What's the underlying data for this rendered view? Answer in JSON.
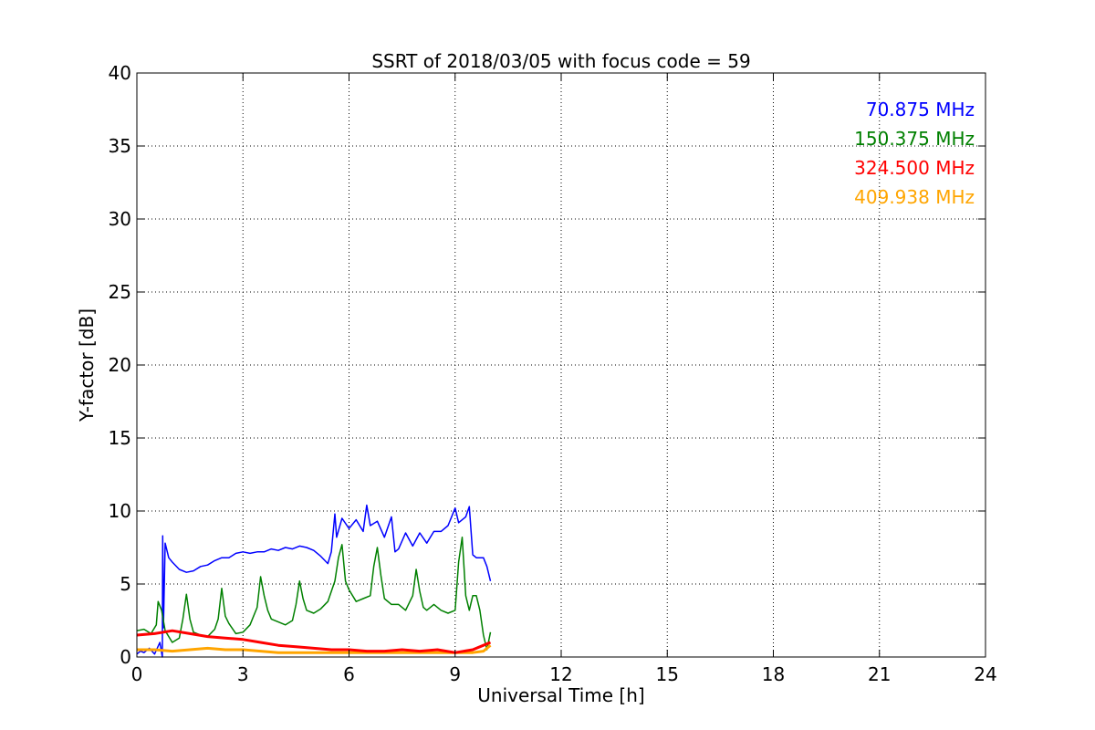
{
  "chart_data": {
    "type": "line",
    "title": "SSRT of 2018/03/05 with focus code = 59",
    "xlabel": "Universal Time [h]",
    "ylabel": "Y-factor [dB]",
    "xlim": [
      0,
      24
    ],
    "ylim": [
      0,
      40
    ],
    "xticks": [
      0,
      3,
      6,
      9,
      12,
      15,
      18,
      21,
      24
    ],
    "yticks": [
      0,
      5,
      10,
      15,
      20,
      25,
      30,
      35,
      40
    ],
    "grid": true,
    "legend_position": "top-right",
    "series": [
      {
        "name": "70.875 MHz",
        "color": "#0000ff",
        "x": [
          0.0,
          0.1,
          0.2,
          0.35,
          0.5,
          0.65,
          0.72,
          0.73,
          0.75,
          0.8,
          0.9,
          1.0,
          1.2,
          1.4,
          1.6,
          1.8,
          2.0,
          2.2,
          2.4,
          2.6,
          2.8,
          3.0,
          3.2,
          3.4,
          3.6,
          3.8,
          4.0,
          4.2,
          4.4,
          4.6,
          4.8,
          5.0,
          5.2,
          5.4,
          5.5,
          5.6,
          5.65,
          5.8,
          6.0,
          6.2,
          6.4,
          6.5,
          6.6,
          6.8,
          7.0,
          7.2,
          7.3,
          7.4,
          7.6,
          7.8,
          8.0,
          8.2,
          8.4,
          8.6,
          8.8,
          9.0,
          9.1,
          9.3,
          9.4,
          9.5,
          9.6,
          9.8,
          9.9,
          10.0
        ],
        "y": [
          0.2,
          0.4,
          0.3,
          0.6,
          0.2,
          1.0,
          0.0,
          8.3,
          2.0,
          7.8,
          6.8,
          6.5,
          6.0,
          5.8,
          5.9,
          6.2,
          6.3,
          6.6,
          6.8,
          6.8,
          7.1,
          7.2,
          7.1,
          7.2,
          7.2,
          7.4,
          7.3,
          7.5,
          7.4,
          7.6,
          7.5,
          7.3,
          6.9,
          6.4,
          7.2,
          9.8,
          8.2,
          9.5,
          8.8,
          9.4,
          8.6,
          10.4,
          9.0,
          9.3,
          8.2,
          9.6,
          7.2,
          7.4,
          8.5,
          7.6,
          8.5,
          7.8,
          8.6,
          8.6,
          9.0,
          10.2,
          9.2,
          9.6,
          10.3,
          7.0,
          6.8,
          6.8,
          6.2,
          5.2
        ]
      },
      {
        "name": "150.375 MHz",
        "color": "#008000",
        "x": [
          0.0,
          0.2,
          0.4,
          0.55,
          0.6,
          0.7,
          0.8,
          1.0,
          1.2,
          1.3,
          1.4,
          1.5,
          1.6,
          1.8,
          2.0,
          2.2,
          2.3,
          2.4,
          2.5,
          2.6,
          2.8,
          3.0,
          3.2,
          3.4,
          3.5,
          3.6,
          3.7,
          3.8,
          4.0,
          4.2,
          4.4,
          4.5,
          4.6,
          4.7,
          4.8,
          5.0,
          5.2,
          5.4,
          5.6,
          5.7,
          5.8,
          5.9,
          6.0,
          6.2,
          6.4,
          6.6,
          6.7,
          6.8,
          6.9,
          7.0,
          7.2,
          7.4,
          7.6,
          7.8,
          7.9,
          8.0,
          8.1,
          8.2,
          8.4,
          8.6,
          8.8,
          9.0,
          9.1,
          9.2,
          9.3,
          9.4,
          9.5,
          9.6,
          9.7,
          9.8,
          9.9,
          10.0
        ],
        "y": [
          1.8,
          1.9,
          1.6,
          2.2,
          3.8,
          3.2,
          1.8,
          1.0,
          1.3,
          2.6,
          4.3,
          2.6,
          1.7,
          1.5,
          1.4,
          1.9,
          2.6,
          4.7,
          2.8,
          2.3,
          1.6,
          1.7,
          2.2,
          3.4,
          5.5,
          4.2,
          3.2,
          2.6,
          2.4,
          2.2,
          2.5,
          3.6,
          5.2,
          4.0,
          3.2,
          3.0,
          3.3,
          3.8,
          5.2,
          6.8,
          7.7,
          5.2,
          4.6,
          3.8,
          4.0,
          4.2,
          6.2,
          7.5,
          5.6,
          4.0,
          3.6,
          3.6,
          3.2,
          4.2,
          6.0,
          4.5,
          3.4,
          3.2,
          3.6,
          3.2,
          3.0,
          3.2,
          6.5,
          8.2,
          4.2,
          3.2,
          4.2,
          4.2,
          3.2,
          1.5,
          0.5,
          1.7
        ]
      },
      {
        "name": "324.500 MHz",
        "color": "#ff0000",
        "x": [
          0.0,
          0.5,
          1.0,
          1.5,
          2.0,
          2.5,
          3.0,
          3.5,
          4.0,
          4.5,
          5.0,
          5.5,
          6.0,
          6.5,
          7.0,
          7.5,
          8.0,
          8.5,
          9.0,
          9.5,
          9.8,
          10.0
        ],
        "y": [
          1.5,
          1.6,
          1.8,
          1.6,
          1.4,
          1.3,
          1.2,
          1.0,
          0.8,
          0.7,
          0.6,
          0.5,
          0.5,
          0.4,
          0.4,
          0.5,
          0.4,
          0.5,
          0.3,
          0.5,
          0.8,
          1.0
        ]
      },
      {
        "name": "409.938 MHz",
        "color": "#ffa500",
        "x": [
          0.0,
          0.5,
          1.0,
          1.5,
          2.0,
          2.5,
          3.0,
          3.5,
          4.0,
          4.5,
          5.0,
          5.5,
          6.0,
          6.5,
          7.0,
          7.5,
          8.0,
          8.5,
          9.0,
          9.5,
          9.8,
          10.0
        ],
        "y": [
          0.5,
          0.5,
          0.4,
          0.5,
          0.6,
          0.5,
          0.5,
          0.4,
          0.3,
          0.3,
          0.3,
          0.3,
          0.3,
          0.3,
          0.3,
          0.3,
          0.3,
          0.3,
          0.3,
          0.3,
          0.4,
          0.8
        ]
      }
    ]
  }
}
